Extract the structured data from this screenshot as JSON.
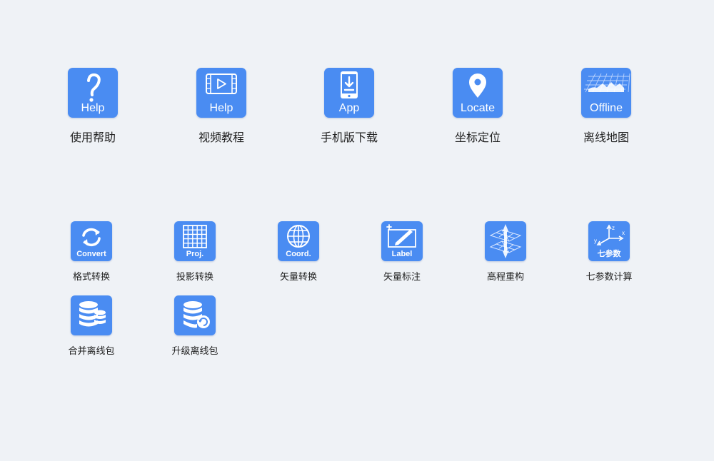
{
  "colors": {
    "background": "#eff2f6",
    "icon": "#4a8cf2",
    "label": "#222222"
  },
  "top_row": [
    {
      "icon": "question-icon",
      "icon_text": "Help",
      "label": "使用帮助"
    },
    {
      "icon": "video-icon",
      "icon_text": "Help",
      "label": "视频教程"
    },
    {
      "icon": "phone-download-icon",
      "icon_text": "App",
      "label": "手机版下载"
    },
    {
      "icon": "location-pin-icon",
      "icon_text": "Locate",
      "label": "坐标定位"
    },
    {
      "icon": "map-grid-icon",
      "icon_text": "Offline",
      "label": "离线地图"
    }
  ],
  "tools": [
    {
      "icon": "convert-arrows-icon",
      "icon_text": "Convert",
      "label": "格式转换"
    },
    {
      "icon": "grid-icon",
      "icon_text": "Proj.",
      "label": "投影转换"
    },
    {
      "icon": "globe-icon",
      "icon_text": "Coord.",
      "label": "矢量转换"
    },
    {
      "icon": "label-edit-icon",
      "icon_text": "Label",
      "label": "矢量标注"
    },
    {
      "icon": "elevation-icon",
      "icon_text": "",
      "label": "高程重构"
    },
    {
      "icon": "axes-icon",
      "icon_text": "七参数",
      "label": "七参数计算"
    },
    {
      "icon": "database-icon",
      "icon_text": "",
      "label": "合并离线包"
    },
    {
      "icon": "database-refresh-icon",
      "icon_text": "",
      "label": "升级离线包"
    }
  ]
}
